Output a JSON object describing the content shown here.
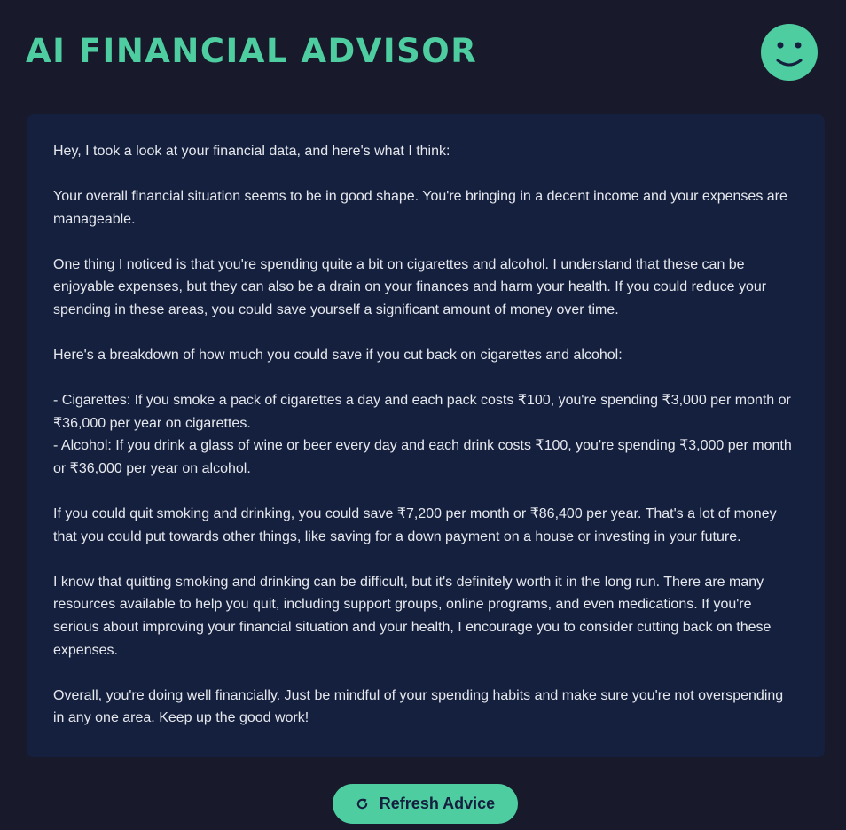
{
  "header": {
    "title": "AI FINANCIAL ADVISOR",
    "avatar_icon": "smiley-face-icon"
  },
  "advice": {
    "paragraphs": [
      [
        "Hey, I took a look at your financial data, and here's what I think:"
      ],
      [
        "Your overall financial situation seems to be in good shape. You're bringing in a decent income and your expenses are manageable."
      ],
      [
        "One thing I noticed is that you're spending quite a bit on cigarettes and alcohol. I understand that these can be enjoyable expenses, but they can also be a drain on your finances and harm your health. If you could reduce your spending in these areas, you could save yourself a significant amount of money over time."
      ],
      [
        "Here's a breakdown of how much you could save if you cut back on cigarettes and alcohol:"
      ],
      [
        "- Cigarettes: If you smoke a pack of cigarettes a day and each pack costs ₹100, you're spending ₹3,000 per month or ₹36,000 per year on cigarettes.",
        "- Alcohol: If you drink a glass of wine or beer every day and each drink costs ₹100, you're spending ₹3,000 per month or ₹36,000 per year on alcohol."
      ],
      [
        "If you could quit smoking and drinking, you could save ₹7,200 per month or ₹86,400 per year. That's a lot of money that you could put towards other things, like saving for a down payment on a house or investing in your future."
      ],
      [
        "I know that quitting smoking and drinking can be difficult, but it's definitely worth it in the long run. There are many resources available to help you quit, including support groups, online programs, and even medications. If you're serious about improving your financial situation and your health, I encourage you to consider cutting back on these expenses."
      ],
      [
        "Overall, you're doing well financially. Just be mindful of your spending habits and make sure you're not overspending in any one area. Keep up the good work!"
      ]
    ]
  },
  "actions": {
    "refresh_label": "Refresh Advice",
    "refresh_icon": "refresh-icon"
  },
  "colors": {
    "background": "#181a2b",
    "card": "#14203d",
    "accent": "#4ecda0",
    "text": "#e6e8ee"
  }
}
